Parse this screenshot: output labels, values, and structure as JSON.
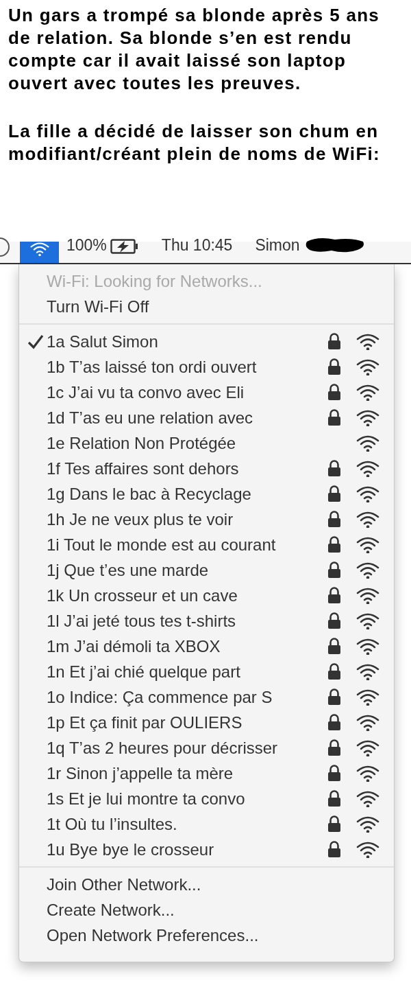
{
  "caption": [
    "Un gars a trompé sa blonde après 5 ans de relation. Sa blonde s’en est rendu compte car il avait laissé son laptop ouvert avec toutes les preuves.",
    "La fille a décidé de laisser son chum en modifiant/créant plein de noms de WiFi:"
  ],
  "menu_bar": {
    "battery": "100%",
    "clock": "Thu 10:45",
    "user": "Simon"
  },
  "wifi_menu": {
    "header": [
      {
        "label": "Wi-Fi: Looking for Networks...",
        "disabled": true
      },
      {
        "label": "Turn Wi-Fi Off",
        "disabled": false
      }
    ],
    "networks": [
      {
        "name": "1a Salut Simon",
        "selected": true,
        "locked": true
      },
      {
        "name": "1b T’as laissé ton ordi ouvert",
        "selected": false,
        "locked": true
      },
      {
        "name": "1c J’ai vu ta convo avec Eli",
        "selected": false,
        "locked": true
      },
      {
        "name": "1d T’as eu une relation avec",
        "selected": false,
        "locked": true
      },
      {
        "name": "1e Relation Non Protégée",
        "selected": false,
        "locked": false
      },
      {
        "name": "1f Tes affaires sont dehors",
        "selected": false,
        "locked": true
      },
      {
        "name": "1g Dans le bac à Recyclage",
        "selected": false,
        "locked": true
      },
      {
        "name": "1h Je ne veux plus te voir",
        "selected": false,
        "locked": true
      },
      {
        "name": "1i Tout le monde est au courant",
        "selected": false,
        "locked": true
      },
      {
        "name": "1j Que t’es une marde",
        "selected": false,
        "locked": true
      },
      {
        "name": "1k Un crosseur et un cave",
        "selected": false,
        "locked": true
      },
      {
        "name": "1l J’ai jeté tous tes t-shirts",
        "selected": false,
        "locked": true
      },
      {
        "name": "1m J’ai démoli ta XBOX",
        "selected": false,
        "locked": true
      },
      {
        "name": "1n Et j’ai chié quelque part",
        "selected": false,
        "locked": true
      },
      {
        "name": "1o Indice: Ça commence par S",
        "selected": false,
        "locked": true
      },
      {
        "name": "1p Et ça finit par OULIERS",
        "selected": false,
        "locked": true
      },
      {
        "name": "1q T’as 2 heures pour décrisser",
        "selected": false,
        "locked": true
      },
      {
        "name": "1r Sinon j’appelle ta mère",
        "selected": false,
        "locked": true
      },
      {
        "name": "1s Et je lui montre ta convo",
        "selected": false,
        "locked": true
      },
      {
        "name": "1t Où tu l’insultes.",
        "selected": false,
        "locked": true
      },
      {
        "name": "1u Bye bye le crosseur",
        "selected": false,
        "locked": true
      }
    ],
    "footer": [
      "Join Other Network...",
      "Create Network...",
      "Open Network Preferences..."
    ]
  }
}
